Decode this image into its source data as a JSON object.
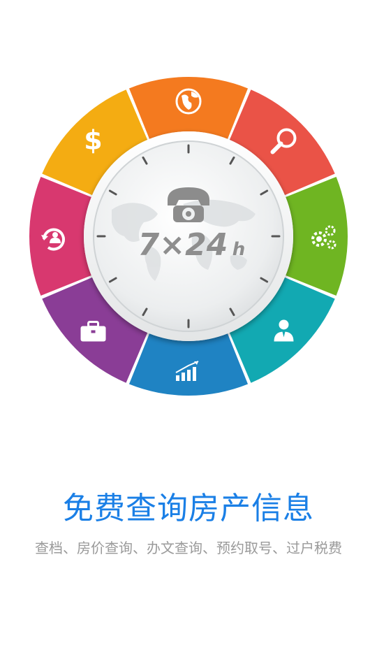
{
  "dial": {
    "center_label": "7×24h",
    "center_label_main": "7×24",
    "center_label_suffix": "h",
    "segments": [
      {
        "name": "globe",
        "color": "#f47a1f",
        "icon": "globe-icon"
      },
      {
        "name": "search",
        "color": "#ea5347",
        "icon": "magnifier-icon"
      },
      {
        "name": "settings",
        "color": "#6fb522",
        "icon": "gears-icon"
      },
      {
        "name": "person",
        "color": "#12a9b2",
        "icon": "person-icon"
      },
      {
        "name": "chart",
        "color": "#1f83c3",
        "icon": "growth-chart-icon"
      },
      {
        "name": "briefcase",
        "color": "#8a3d96",
        "icon": "briefcase-icon"
      },
      {
        "name": "refresh",
        "color": "#d8386f",
        "icon": "refresh-person-icon"
      },
      {
        "name": "money",
        "color": "#f4ac12",
        "icon": "dollar-icon"
      }
    ]
  },
  "headline": "免费查询房产信息",
  "subline": "查档、房价查询、办文查询、预约取号、过户税费"
}
